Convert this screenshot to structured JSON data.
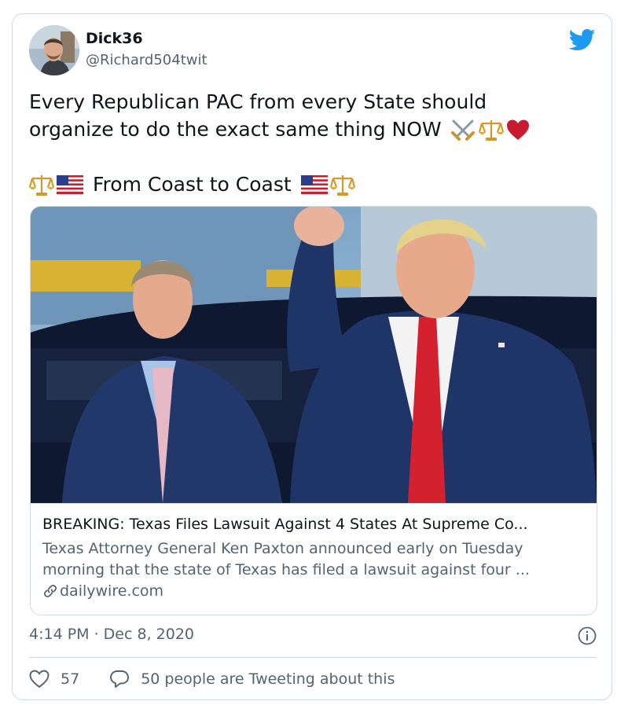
{
  "tweet": {
    "display_name": "Dick36",
    "handle": "@Richard504twit",
    "text_line1": "Every Republican PAC from every State should",
    "text_line2": "organize to do the exact same thing NOW",
    "text_line3": "From Coast to Coast",
    "timestamp": "4:14 PM · Dec 8, 2020",
    "like_count": "57",
    "reply_text": "50 people are Tweeting about this"
  },
  "link_card": {
    "title": "BREAKING: Texas Files Lawsuit Against 4 States At Supreme Co...",
    "desc_line1": "Texas Attorney General Ken Paxton announced early on Tuesday",
    "desc_line2": "morning that the state of Texas has filed a lawsuit against four ...",
    "domain": "dailywire.com"
  },
  "icons": {
    "brand": "twitter-bird-icon",
    "emoji": [
      "crossed-swords-icon",
      "balance-scale-icon",
      "red-heart-icon",
      "us-flag-icon"
    ],
    "info": "info-icon",
    "like": "heart-outline-icon",
    "reply": "speech-bubble-icon",
    "link": "link-icon"
  },
  "colors": {
    "twitter_blue": "#1d9bf0",
    "text_primary": "#0f1419",
    "text_secondary": "#536471",
    "border": "#cfd9de",
    "heart_red": "#c91a2e",
    "tie_red": "#d4212f",
    "suit_navy": "#1f3568"
  }
}
